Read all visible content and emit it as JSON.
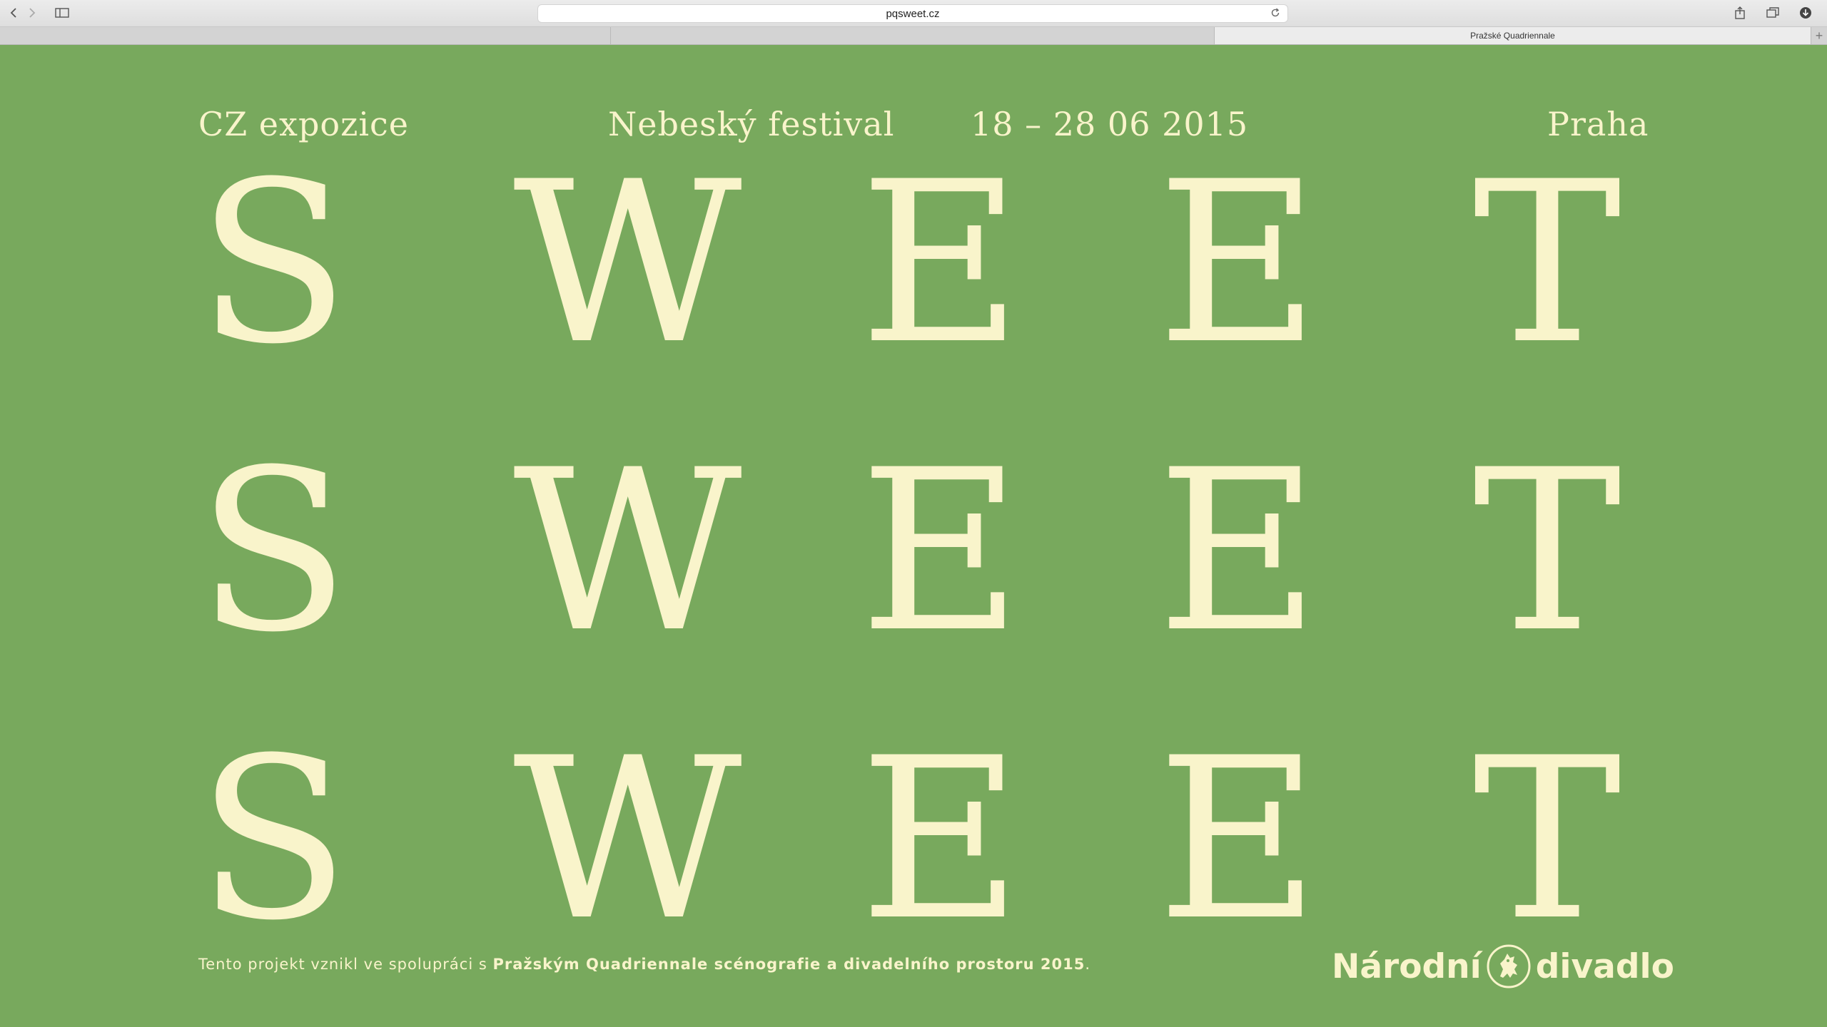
{
  "browser": {
    "url": "pqsweet.cz",
    "tabs": [
      {
        "label": ""
      },
      {
        "label": ""
      },
      {
        "label": "Pražské Quadriennale"
      }
    ],
    "new_tab_label": "+"
  },
  "header": {
    "exhibit": "CZ expozice",
    "festival": "Nebeský festival",
    "dates": "18 – 28 06 2015",
    "city": "Praha"
  },
  "hero": {
    "rows": [
      [
        "S",
        "W",
        "E",
        "E",
        "T"
      ],
      [
        "S",
        "W",
        "E",
        "E",
        "T"
      ],
      [
        "S",
        "W",
        "E",
        "E",
        "T"
      ]
    ]
  },
  "footer": {
    "credit_prefix": "Tento projekt vznikl ve spolupráci s ",
    "credit_bold": "Pražským Quadriennale scénografie a divadelního prostoru 2015",
    "credit_suffix": ".",
    "logo_left": "Národní",
    "logo_right": "divadlo"
  },
  "colors": {
    "background": "#78a95d",
    "text": "#f9f4cb"
  },
  "icons": [
    "back-icon",
    "forward-icon",
    "sidebar-icon",
    "reload-icon",
    "share-icon",
    "tabs-overview-icon",
    "downloads-icon",
    "lion-emblem-icon"
  ]
}
